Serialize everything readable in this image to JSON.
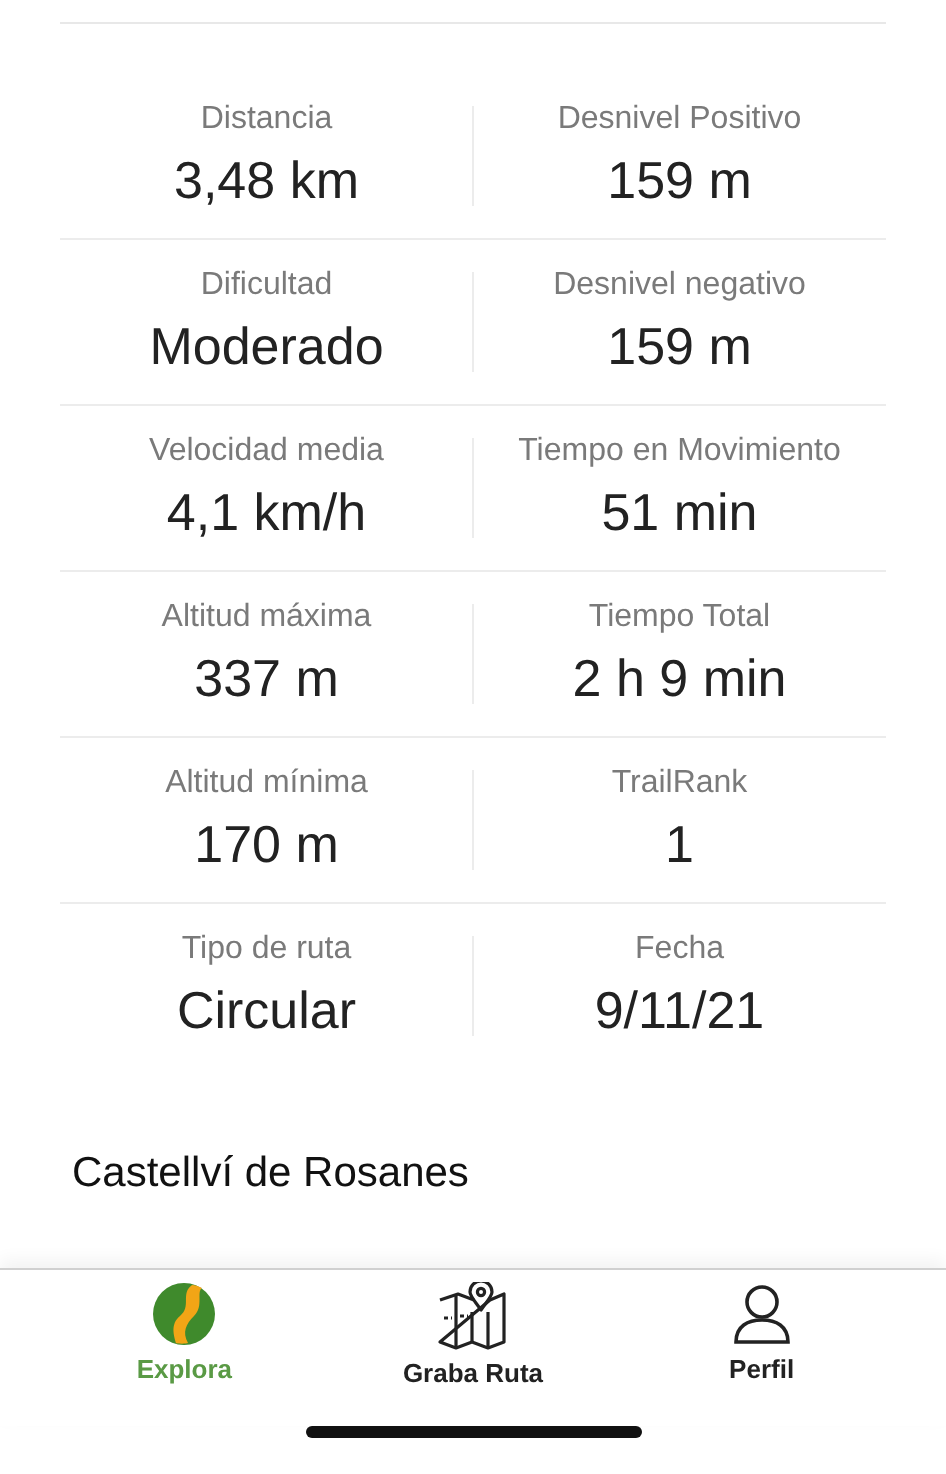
{
  "stats": [
    {
      "left": {
        "label": "Distancia",
        "value": "3,48 km"
      },
      "right": {
        "label": "Desnivel Positivo",
        "value": "159 m"
      }
    },
    {
      "left": {
        "label": "Dificultad",
        "value": "Moderado"
      },
      "right": {
        "label": "Desnivel negativo",
        "value": "159 m"
      }
    },
    {
      "left": {
        "label": "Velocidad media",
        "value": "4,1 km/h"
      },
      "right": {
        "label": "Tiempo en Movimiento",
        "value": "51 min"
      }
    },
    {
      "left": {
        "label": "Altitud máxima",
        "value": "337 m"
      },
      "right": {
        "label": "Tiempo Total",
        "value": "2 h 9 min"
      }
    },
    {
      "left": {
        "label": "Altitud mínima",
        "value": "170 m"
      },
      "right": {
        "label": "TrailRank",
        "value": "1"
      }
    },
    {
      "left": {
        "label": "Tipo de ruta",
        "value": "Circular"
      },
      "right": {
        "label": "Fecha",
        "value": "9/11/21"
      }
    }
  ],
  "location": "Castellví de Rosanes",
  "tab_bar": [
    {
      "kind": "logo",
      "label": "Explora",
      "selected": true
    },
    {
      "kind": "map",
      "label": "Graba Ruta",
      "selected": false
    },
    {
      "kind": "profile",
      "label": "Perfil",
      "selected": false
    }
  ]
}
